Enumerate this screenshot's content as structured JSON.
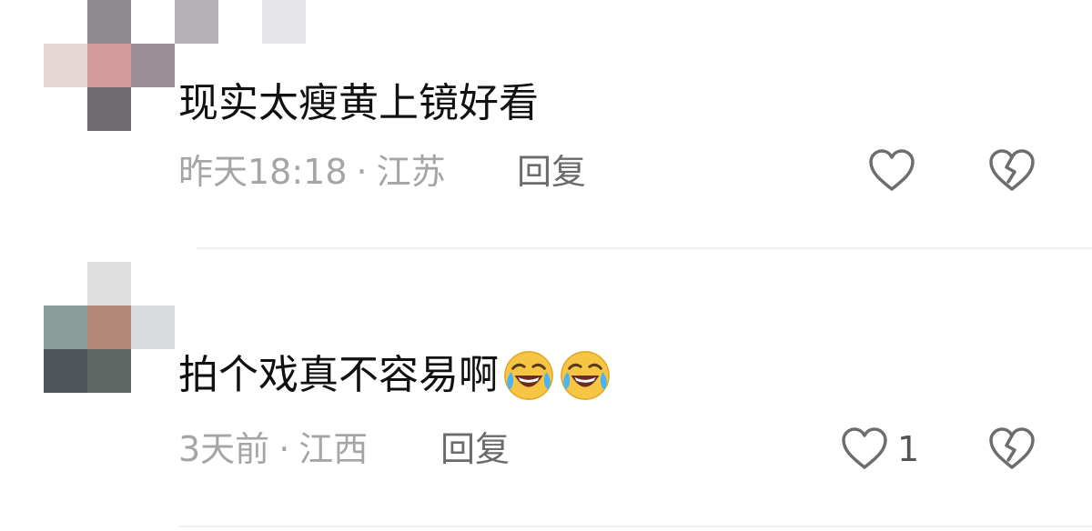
{
  "comments": [
    {
      "text": "现实太瘦黄上镜好看",
      "time": "昨天18:18",
      "separator": "·",
      "location": "江苏",
      "reply_label": "回复",
      "like_count": "",
      "avatar_colors": [
        "#9a9a9a",
        "#e6d6d6",
        "#d39c9a",
        "#9d8f96",
        "#6f6a6d",
        "#b3b1b5",
        "#e5e5e7"
      ]
    },
    {
      "text": "拍个戏真不容易啊",
      "emojis": [
        "laughing-crying-emoji",
        "laughing-crying-emoji"
      ],
      "time": "3天前",
      "separator": "·",
      "location": "江西",
      "reply_label": "回复",
      "like_count": "1",
      "avatar_colors": [
        "#dedede",
        "#8a9c99",
        "#b28978",
        "#d8dadc",
        "#4f575c",
        "#5f6764"
      ]
    }
  ]
}
